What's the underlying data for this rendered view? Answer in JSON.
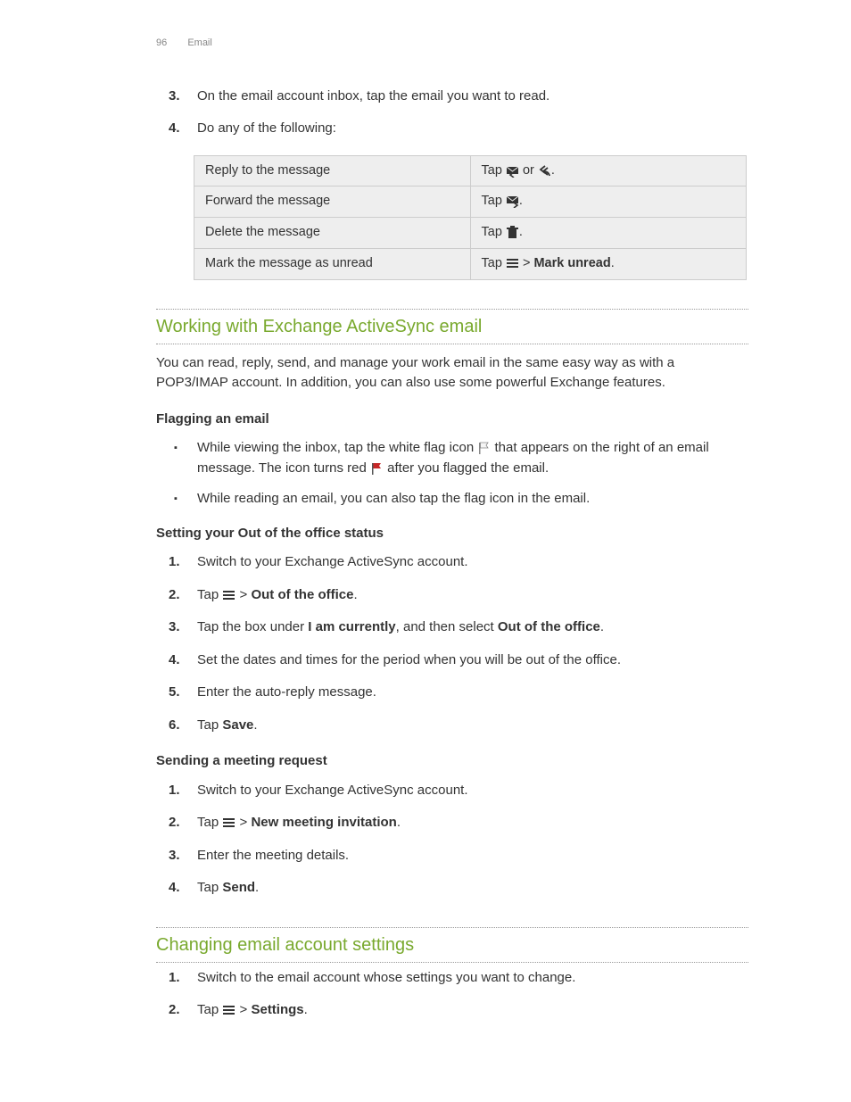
{
  "header": {
    "page_number": "96",
    "chapter": "Email"
  },
  "top_steps": [
    {
      "n": "3.",
      "text": "On the email account inbox, tap the email you want to read."
    },
    {
      "n": "4.",
      "text": "Do any of the following:"
    }
  ],
  "actions_table": [
    {
      "left": "Reply to the message",
      "right": [
        {
          "t": "Tap "
        },
        {
          "icon": "reply-icon"
        },
        {
          "t": " or "
        },
        {
          "icon": "reply-all-icon"
        },
        {
          "t": "."
        }
      ]
    },
    {
      "left": "Forward the message",
      "right": [
        {
          "t": "Tap "
        },
        {
          "icon": "forward-icon"
        },
        {
          "t": "."
        }
      ]
    },
    {
      "left": "Delete the message",
      "right": [
        {
          "t": "Tap "
        },
        {
          "icon": "trash-icon"
        },
        {
          "t": "."
        }
      ]
    },
    {
      "left": "Mark the message as unread",
      "right": [
        {
          "t": "Tap "
        },
        {
          "icon": "menu-icon"
        },
        {
          "t": " > "
        },
        {
          "b": "Mark unread"
        },
        {
          "t": "."
        }
      ]
    }
  ],
  "section_activesync": {
    "heading": "Working with Exchange ActiveSync email",
    "intro": "You can read, reply, send, and manage your work email in the same easy way as with a POP3/IMAP account. In addition, you can also use some powerful Exchange features.",
    "sub_flagging": {
      "title": "Flagging an email",
      "items": [
        [
          {
            "t": "While viewing the inbox, tap the white flag icon "
          },
          {
            "icon": "flag-white-icon"
          },
          {
            "t": " that appears on the right of an email message. The icon turns red "
          },
          {
            "icon": "flag-red-icon"
          },
          {
            "t": " after you flagged the email."
          }
        ],
        [
          {
            "t": "While reading an email, you can also tap the flag icon in the email."
          }
        ]
      ]
    },
    "sub_ooo": {
      "title": "Setting your Out of the office status",
      "steps": [
        [
          {
            "t": "Switch to your Exchange ActiveSync account."
          }
        ],
        [
          {
            "t": "Tap "
          },
          {
            "icon": "menu-icon"
          },
          {
            "t": " > "
          },
          {
            "b": "Out of the office"
          },
          {
            "t": "."
          }
        ],
        [
          {
            "t": "Tap the box under "
          },
          {
            "b": "I am currently"
          },
          {
            "t": ", and then select "
          },
          {
            "b": "Out of the office"
          },
          {
            "t": "."
          }
        ],
        [
          {
            "t": "Set the dates and times for the period when you will be out of the office."
          }
        ],
        [
          {
            "t": "Enter the auto-reply message."
          }
        ],
        [
          {
            "t": "Tap "
          },
          {
            "b": "Save"
          },
          {
            "t": "."
          }
        ]
      ]
    },
    "sub_meeting": {
      "title": "Sending a meeting request",
      "steps": [
        [
          {
            "t": "Switch to your Exchange ActiveSync account."
          }
        ],
        [
          {
            "t": "Tap "
          },
          {
            "icon": "menu-icon"
          },
          {
            "t": " > "
          },
          {
            "b": "New meeting invitation"
          },
          {
            "t": "."
          }
        ],
        [
          {
            "t": "Enter the meeting details."
          }
        ],
        [
          {
            "t": "Tap "
          },
          {
            "b": "Send"
          },
          {
            "t": "."
          }
        ]
      ]
    }
  },
  "section_settings": {
    "heading": "Changing email account settings",
    "steps": [
      [
        {
          "t": "Switch to the email account whose settings you want to change."
        }
      ],
      [
        {
          "t": "Tap "
        },
        {
          "icon": "menu-icon"
        },
        {
          "t": " > "
        },
        {
          "b": "Settings"
        },
        {
          "t": "."
        }
      ]
    ]
  }
}
